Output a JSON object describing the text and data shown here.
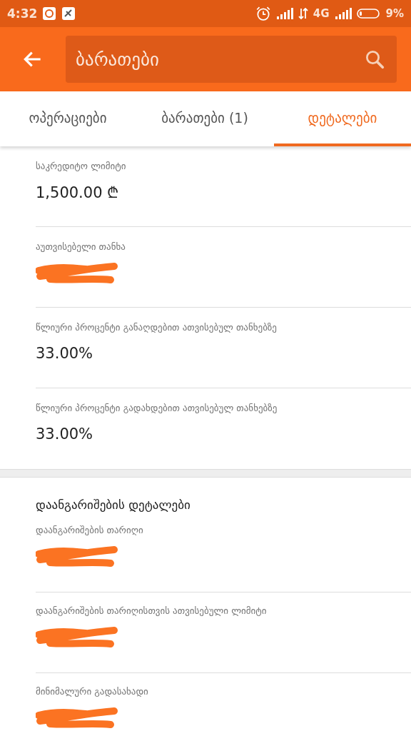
{
  "status_bar": {
    "time": "4:32",
    "network": "4G",
    "battery": "9%"
  },
  "app_bar": {
    "search_value": "ბარათები"
  },
  "tabs": [
    {
      "label": "ოპერაციები",
      "selected": false
    },
    {
      "label": "ბარათები (1)",
      "selected": false
    },
    {
      "label": "დეტალები",
      "selected": true
    }
  ],
  "details": [
    {
      "label": "საკრედიტო ლიმიტი",
      "value": "1,500.00 ₾",
      "redacted": false
    },
    {
      "label": "აუთვისებელი თანხა",
      "redacted": true
    },
    {
      "label": "წლიური პროცენტი განაღდებით ათვისებულ თანხებზე",
      "value": "33.00%",
      "redacted": false
    },
    {
      "label": "წლიური პროცენტი გადახდებით ათვისებულ თანხებზე",
      "value": "33.00%",
      "redacted": false
    }
  ],
  "settlement": {
    "title": "დაანგარიშების დეტალები",
    "items": [
      {
        "label": "დაანგარიშების თარიღი",
        "redacted": true
      },
      {
        "label": "დაანგარიშების თარიღისთვის ათვისებული ლიმიტი",
        "redacted": true
      },
      {
        "label": "მინიმალური გადასახადი",
        "redacted": true
      }
    ]
  }
}
